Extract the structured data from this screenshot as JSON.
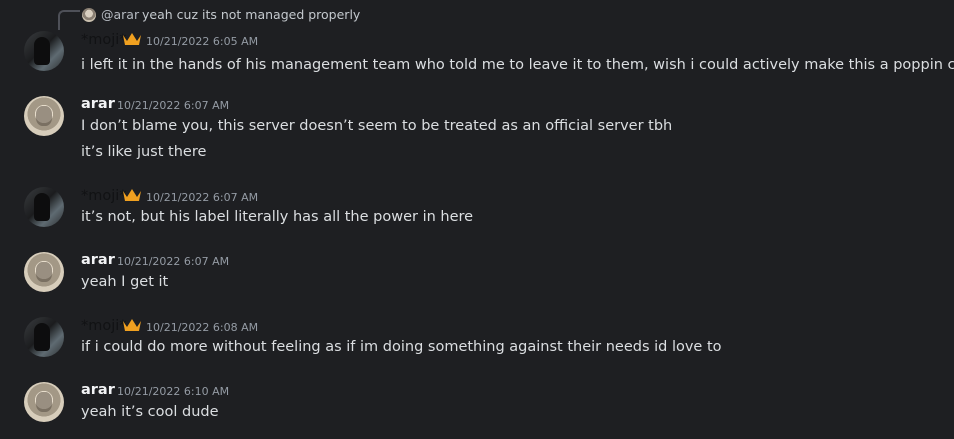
{
  "reply": {
    "mention": "@arar",
    "text": "yeah cuz its not managed properly"
  },
  "messages": [
    {
      "author": "*moji*",
      "timestamp": "10/21/2022 6:05 AM",
      "lines": [
        "i left it in the hands of his management team who told me to leave it to them, wish i could actively make this a poppin cord"
      ],
      "badge": "crown-icon"
    },
    {
      "author": "arar",
      "timestamp": "10/21/2022 6:07 AM",
      "lines": [
        "I don’t blame you, this server doesn’t seem to be treated as an official server tbh",
        "it’s like just there"
      ]
    },
    {
      "author": "*moji*",
      "timestamp": "10/21/2022 6:07 AM",
      "lines": [
        "it’s not, but his label literally has all the power in here"
      ],
      "badge": "crown-icon"
    },
    {
      "author": "arar",
      "timestamp": "10/21/2022 6:07 AM",
      "lines": [
        "yeah I get it"
      ]
    },
    {
      "author": "*moji*",
      "timestamp": "10/21/2022 6:08 AM",
      "lines": [
        "if i could do more without feeling as if im doing something against their needs id love to"
      ],
      "badge": "crown-icon"
    },
    {
      "author": "arar",
      "timestamp": "10/21/2022 6:10 AM",
      "lines": [
        "yeah it’s cool dude"
      ]
    }
  ],
  "colors": {
    "background": "#1e1f22",
    "crown": "#f0a020",
    "timestamp": "#949ba4",
    "text": "#dbdee1"
  }
}
